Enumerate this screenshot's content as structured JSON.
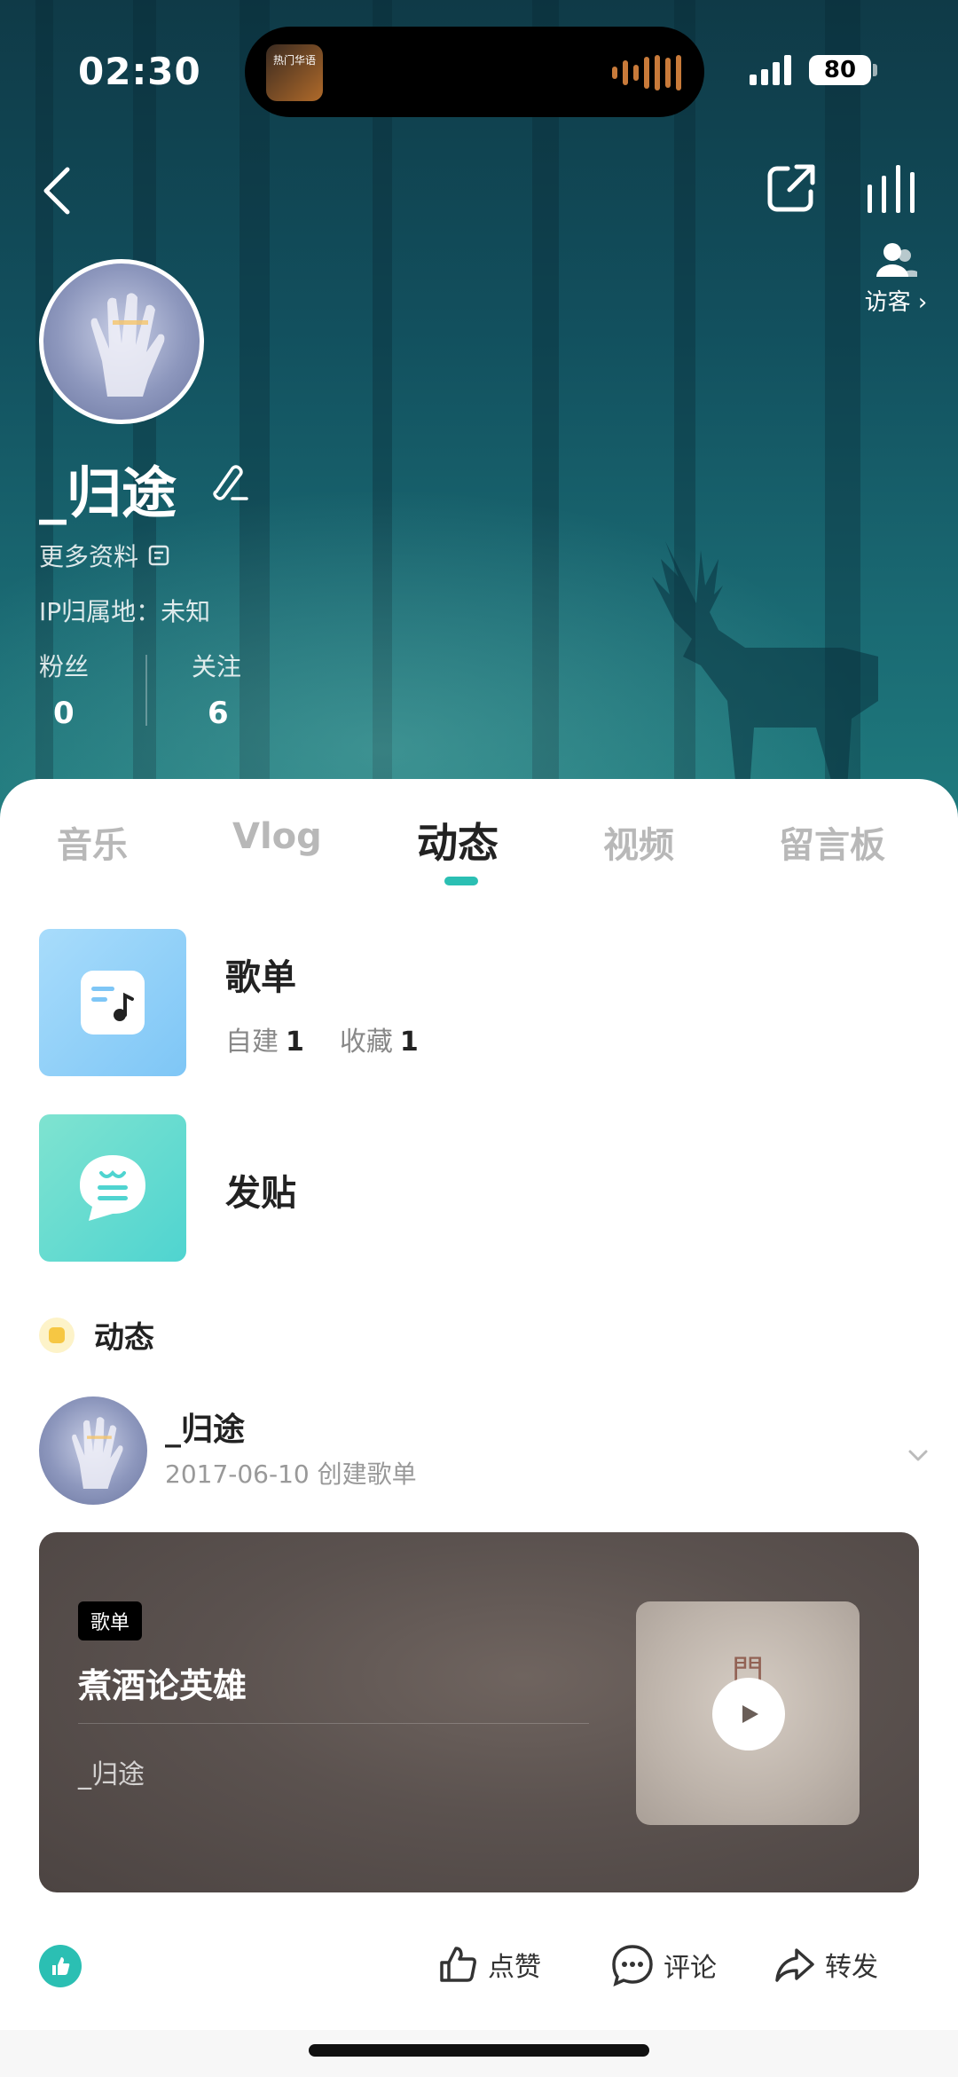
{
  "status_bar": {
    "time": "02:30",
    "island_thumb_text": "热门华语",
    "battery": "80"
  },
  "header": {
    "visitor_label": "访客",
    "username": "_归途",
    "more_info": "更多资料",
    "ip_location": "IP归属地：未知",
    "stats": [
      {
        "label": "粉丝",
        "value": "0"
      },
      {
        "label": "关注",
        "value": "6"
      }
    ]
  },
  "tabs": [
    {
      "label": "音乐",
      "active": false
    },
    {
      "label": "Vlog",
      "active": false
    },
    {
      "label": "动态",
      "active": true
    },
    {
      "label": "视频",
      "active": false
    },
    {
      "label": "留言板",
      "active": false
    }
  ],
  "rows": {
    "playlist": {
      "title": "歌单",
      "created_label": "自建",
      "created_count": "1",
      "collected_label": "收藏",
      "collected_count": "1"
    },
    "post": {
      "title": "发贴"
    }
  },
  "feed": {
    "section_title": "动态",
    "user": "_归途",
    "meta": "2017-06-10 创建歌单",
    "card": {
      "tag": "歌单",
      "title": "煮酒论英雄",
      "author": "_归途",
      "cover_char": "門"
    },
    "actions": {
      "like": "点赞",
      "comment": "评论",
      "share": "转发"
    }
  },
  "colors": {
    "accent": "#2bbfb3",
    "hero_top": "#0f3a47",
    "hero_bottom": "#1f7b7e"
  }
}
